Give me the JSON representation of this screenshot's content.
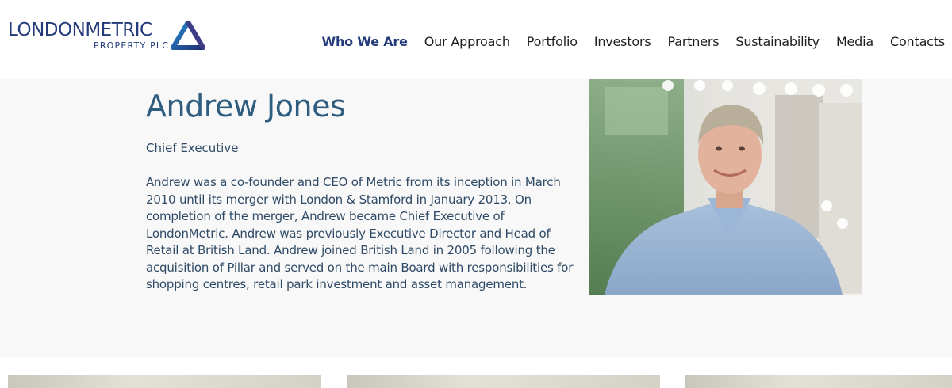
{
  "header": {
    "logo": {
      "line1_part1": "LONDON",
      "line1_part2": "METRIC",
      "line2": "PROPERTY PLC",
      "mark_icon": "triangle-logo-icon"
    },
    "nav": [
      {
        "label": "Who We Are",
        "active": true
      },
      {
        "label": "Our Approach",
        "active": false
      },
      {
        "label": "Portfolio",
        "active": false
      },
      {
        "label": "Investors",
        "active": false
      },
      {
        "label": "Partners",
        "active": false
      },
      {
        "label": "Sustainability",
        "active": false
      },
      {
        "label": "Media",
        "active": false
      },
      {
        "label": "Contacts",
        "active": false
      }
    ]
  },
  "profile": {
    "name": "Andrew Jones",
    "role": "Chief Executive",
    "bio": "Andrew was a co-founder and CEO of Metric from its inception in March 2010 until its merger with London & Stamford in January 2013. On completion of the merger, Andrew became Chief Executive of LondonMetric. Andrew was previously Executive Director and Head of Retail at British Land. Andrew joined British Land in 2005 following the acquisition of Pillar and served on the main Board with responsibilities for shopping centres, retail park investment and asset management."
  },
  "colors": {
    "brand": "#233b7a",
    "heading": "#2f5d80",
    "text": "#2f4a66",
    "panel": "#f8f8f8"
  }
}
